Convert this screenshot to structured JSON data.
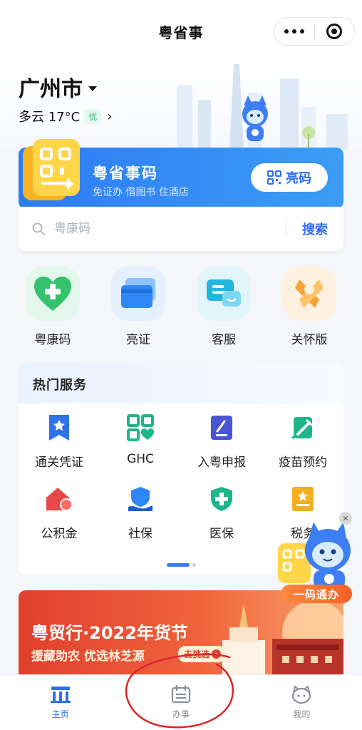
{
  "header": {
    "title": "粤省事",
    "more_icon": "more-dots-icon",
    "close_icon": "target-close-icon"
  },
  "hero": {
    "city": "广州市",
    "weather": "多云 17°C",
    "air_quality": "优"
  },
  "code_card": {
    "title": "粤省事码",
    "subtitle": "免证办 借图书 住酒店",
    "button_label": "亮码"
  },
  "search": {
    "placeholder": "粤康码",
    "button_label": "搜索"
  },
  "quick_entries": [
    {
      "label": "粤康码",
      "icon": "health-heart-icon"
    },
    {
      "label": "亮证",
      "icon": "id-cards-icon"
    },
    {
      "label": "客服",
      "icon": "chat-bubble-icon"
    },
    {
      "label": "关怀版",
      "icon": "care-ribbon-icon"
    }
  ],
  "hot_services": {
    "title": "热门服务",
    "items": [
      {
        "label": "通关凭证",
        "icon": "customs-pass-icon"
      },
      {
        "label": "GHC",
        "icon": "ghc-code-icon"
      },
      {
        "label": "入粤申报",
        "icon": "declaration-icon"
      },
      {
        "label": "疫苗预约",
        "icon": "vaccine-icon"
      },
      {
        "label": "公积金",
        "icon": "housing-fund-icon"
      },
      {
        "label": "社保",
        "icon": "social-security-icon"
      },
      {
        "label": "医保",
        "icon": "medical-insurance-icon"
      },
      {
        "label": "税务",
        "icon": "tax-icon"
      }
    ]
  },
  "banner": {
    "title": "粤贸行·2022年货节",
    "subtitle": "援藏助农 优选林芝源",
    "cta": "去挑选"
  },
  "floating_widget": {
    "label": "一码通办"
  },
  "tabbar": {
    "tabs": [
      {
        "label": "主页",
        "icon": "home-icon",
        "active": true
      },
      {
        "label": "办事",
        "icon": "calendar-icon",
        "active": false
      },
      {
        "label": "我的",
        "icon": "profile-face-icon",
        "active": false
      }
    ]
  },
  "colors": {
    "accent": "#2e6ff0",
    "banner": "#e0402d",
    "health": "#34c26c"
  }
}
